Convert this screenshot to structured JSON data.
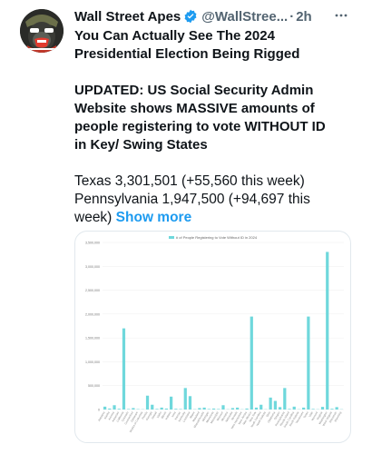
{
  "tweet": {
    "display_name": "Wall Street Apes",
    "handle": "@WallStree...",
    "separator": "·",
    "time": "2h",
    "more_icon": "more-horizontal-icon",
    "headline_line1": "You Can Actually See The 2024",
    "headline_line2": "Presidential Election Being Rigged",
    "updated_line1": "UPDATED: US Social Security Admin",
    "updated_line2": "Website shows MASSIVE amounts of",
    "updated_line3": "people registering to vote WITHOUT ID",
    "updated_line4": "in Key/ Swing States",
    "stat_texas": "Texas 3,301,501 (+55,560 this week)",
    "stat_pa_line1": "Pennsylvania 1,947,500 (+94,697 this",
    "stat_pa_line2": "week)",
    "show_more": "Show more"
  },
  "colors": {
    "accent": "#1d9bf0",
    "bar": "#6fd8dc",
    "verified": "#1d9bf0"
  },
  "chart_data": {
    "type": "bar",
    "title": "# of People Registering to Vote Without ID in 2024",
    "series_name": "# of People Registering to Vote Without ID in 2024",
    "ylim": [
      0,
      3500000
    ],
    "yticks": [
      "0",
      "500,000",
      "1,000,000",
      "1,500,000",
      "2,000,000",
      "2,500,000",
      "3,000,000",
      "3,500,000"
    ],
    "categories": [
      "Alabama",
      "Alaska",
      "Arizona",
      "Arkansas",
      "California",
      "Colorado",
      "Connecticut",
      "Delaware",
      "District of Columbia",
      "Florida",
      "Georgia",
      "Hawaii",
      "Idaho",
      "Illinois",
      "Indiana",
      "Iowa",
      "Kansas",
      "Kentucky",
      "Louisiana",
      "Maine",
      "Maryland",
      "Massachusetts",
      "Michigan",
      "Minnesota",
      "Mississippi",
      "Missouri",
      "Montana",
      "Nebraska",
      "Nevada",
      "New Hampshire",
      "New Jersey",
      "New Mexico",
      "New York",
      "North Carolina",
      "North Dakota",
      "Ohio",
      "Oklahoma",
      "Oregon",
      "Pennsylvania",
      "Rhode Island",
      "South Carolina",
      "South Dakota",
      "Tennessee",
      "Texas",
      "Utah",
      "Vermont",
      "Virginia",
      "Washington",
      "West Virginia",
      "Wisconsin",
      "Wyoming"
    ],
    "values": [
      60000,
      20000,
      90000,
      15000,
      1700000,
      10000,
      30000,
      8000,
      5000,
      290000,
      100000,
      12000,
      40000,
      20000,
      270000,
      15000,
      10000,
      450000,
      280000,
      6000,
      30000,
      40000,
      10000,
      20000,
      10000,
      90000,
      5000,
      30000,
      40000,
      5000,
      20000,
      1947500,
      40000,
      100000,
      5000,
      250000,
      180000,
      50000,
      450000,
      12000,
      60000,
      5000,
      40000,
      1947500,
      12000,
      5000,
      55000,
      3301501,
      15000,
      50000,
      5000
    ]
  }
}
